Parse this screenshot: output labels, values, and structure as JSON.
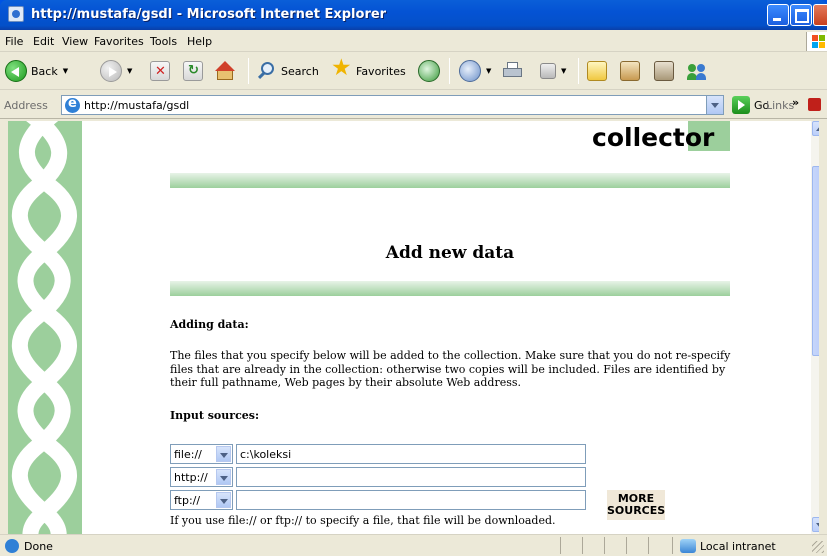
{
  "window": {
    "title": "http://mustafa/gsdl - Microsoft Internet Explorer"
  },
  "menu": [
    "File",
    "Edit",
    "View",
    "Favorites",
    "Tools",
    "Help"
  ],
  "toolbar": {
    "back_label": "Back",
    "search_label": "Search",
    "favorites_label": "Favorites"
  },
  "address": {
    "label": "Address",
    "url": "http://mustafa/gsdl",
    "go_label": "Go",
    "links_label": "Links",
    "links_chevron": "»"
  },
  "page": {
    "header": "collector",
    "title": "Add new data",
    "adding_heading": "Adding data:",
    "description": "The files that you specify below will be added to the collection. Make sure that you do not re-specify files that are already in the collection: otherwise two copies will be included. Files are identified by their full pathname, Web pages by their absolute Web address.",
    "input_heading": "Input sources:",
    "sources": [
      {
        "protocol": "file://",
        "value": "c:\\koleksi"
      },
      {
        "protocol": "http://",
        "value": ""
      },
      {
        "protocol": "ftp://",
        "value": ""
      }
    ],
    "more_sources_line1": "MORE",
    "more_sources_line2": "SOURCES",
    "note": "If you use file:// or ftp:// to specify a file, that file will be downloaded."
  },
  "status": {
    "text": "Done",
    "zone": "Local intranet"
  },
  "colors": {
    "accent_green": "#9ccf9c",
    "xp_blue": "#0054e3"
  }
}
